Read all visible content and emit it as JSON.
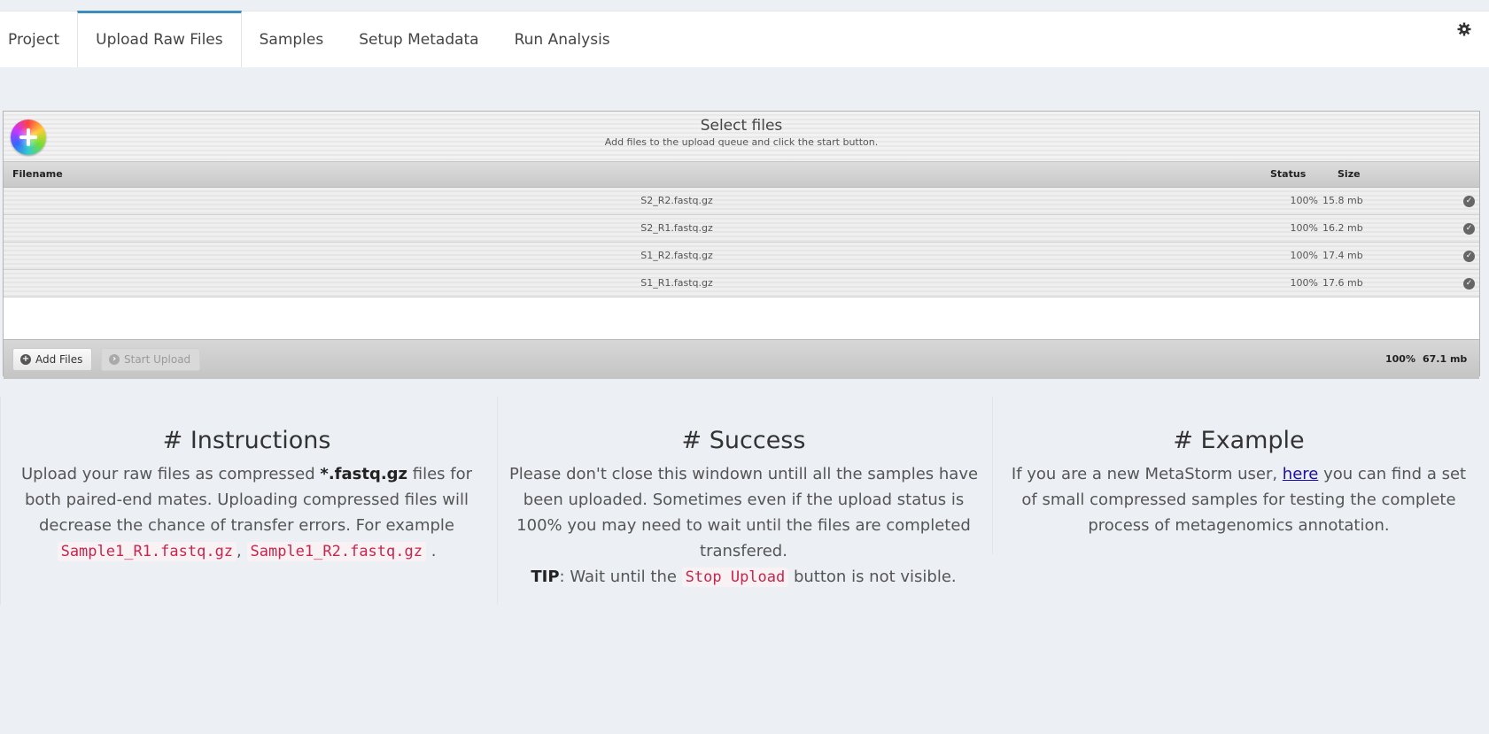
{
  "tabs": [
    {
      "label": "Project",
      "active": false
    },
    {
      "label": "Upload Raw Files",
      "active": true
    },
    {
      "label": "Samples",
      "active": false
    },
    {
      "label": "Setup Metadata",
      "active": false
    },
    {
      "label": "Run Analysis",
      "active": false
    }
  ],
  "settings_icon": "gear-icon",
  "uploader": {
    "title": "Select files",
    "subtitle": "Add files to the upload queue and click the start button.",
    "columns": {
      "filename": "Filename",
      "status": "Status",
      "size": "Size"
    },
    "files": [
      {
        "name": "S2_R2.fastq.gz",
        "status": "100%",
        "size": "15.8 mb"
      },
      {
        "name": "S2_R1.fastq.gz",
        "status": "100%",
        "size": "16.2 mb"
      },
      {
        "name": "S1_R2.fastq.gz",
        "status": "100%",
        "size": "17.4 mb"
      },
      {
        "name": "S1_R1.fastq.gz",
        "status": "100%",
        "size": "17.6 mb"
      }
    ],
    "add_button": "Add Files",
    "start_button": "Start Upload",
    "total_percent": "100%",
    "total_size": "67.1 mb"
  },
  "instructions": {
    "heading": "# Instructions",
    "t1": "Upload your raw files as compressed ",
    "bold": "*.fastq.gz",
    "t2": " files for both paired-end mates. Uploading compressed files will decrease the chance of transfer errors. For example ",
    "code1": "Sample1_R1.fastq.gz",
    "sep": ", ",
    "code2": "Sample1_R2.fastq.gz",
    "end": " ."
  },
  "success": {
    "heading": "# Success",
    "text": "Please don't close this windown untill all the samples have been uploaded. Sometimes even if the upload status is 100% you may need to wait until the files are completed transfered.",
    "tip_label": "TIP",
    "tip_t1": ": Wait until the ",
    "tip_code": "Stop Upload",
    "tip_t2": " button is not visible."
  },
  "example": {
    "heading": "# Example",
    "t1": "If you are a new MetaStorm user, ",
    "link": "here",
    "t2": " you can find a set of small compressed samples for testing the complete process of metagenomics annotation."
  }
}
